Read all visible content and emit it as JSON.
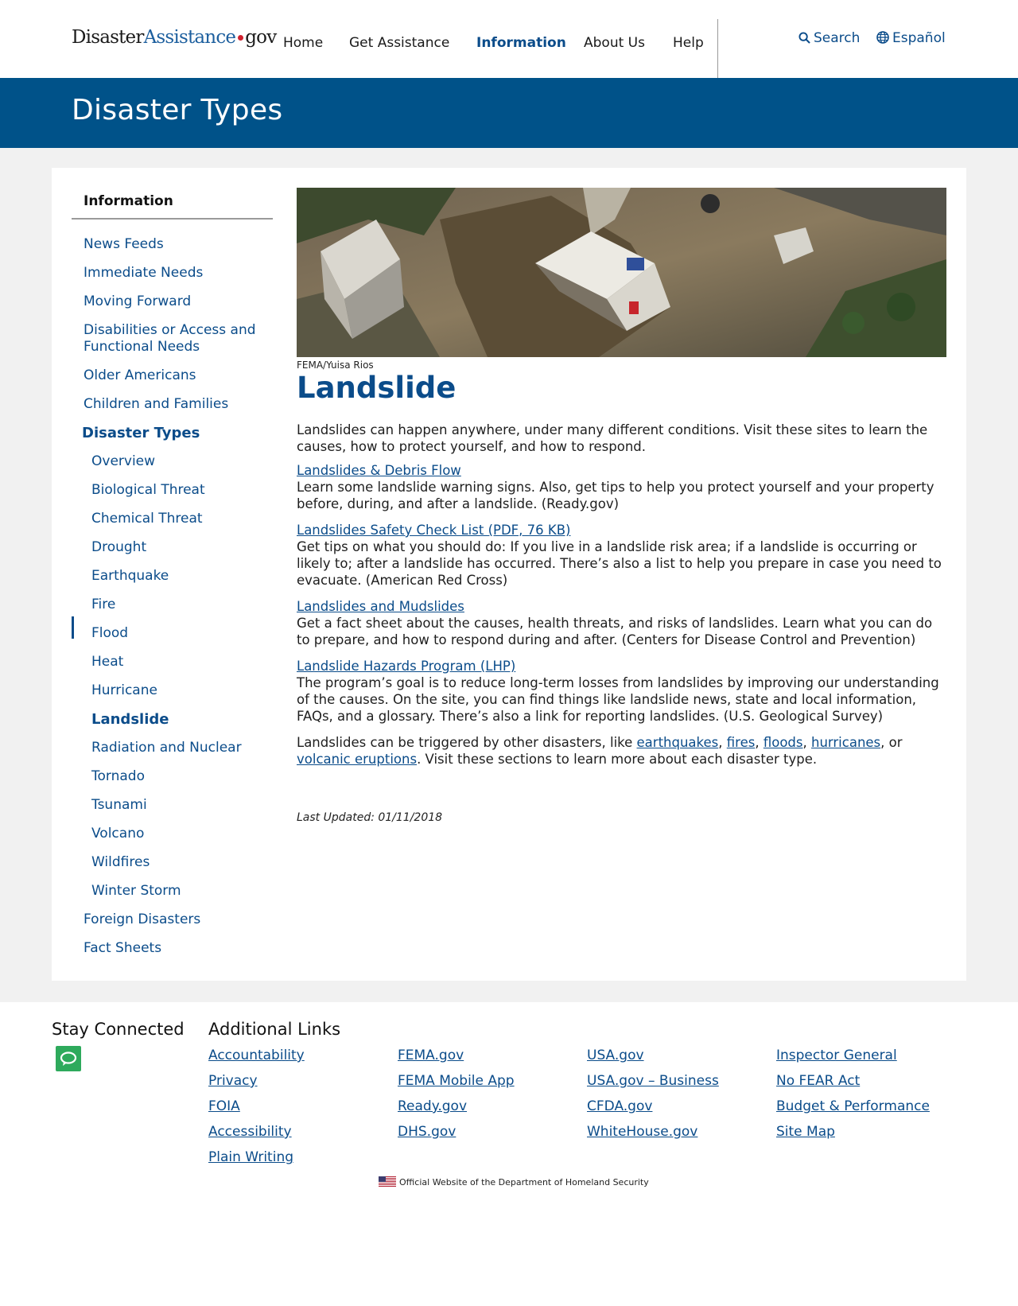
{
  "header": {
    "logo_part1": "Disaster",
    "logo_part2": "Assistance",
    "logo_part3": "gov",
    "nav": [
      "Home",
      "Get Assistance",
      "Information",
      "About Us",
      "Help"
    ],
    "active_nav": "Information",
    "search_label": "Search",
    "language_label": "Español"
  },
  "banner": {
    "title": "Disaster Types"
  },
  "sidenav": {
    "heading": "Information",
    "items_top": [
      "News Feeds",
      "Immediate Needs",
      "Moving Forward",
      "Disabilities or Access and",
      "Functional Needs",
      "Older Americans",
      "Children and Families"
    ],
    "section": "Disaster Types",
    "sub_items": [
      "Overview",
      "Biological Threat",
      "Chemical Threat",
      "Drought",
      "Earthquake",
      "Fire",
      "Flood",
      "Heat",
      "Hurricane",
      "Landslide",
      "Radiation and Nuclear",
      "Tornado",
      "Tsunami",
      "Volcano",
      "Wildfires",
      "Winter Storm"
    ],
    "current": "Landslide",
    "items_bottom": [
      "Foreign Disasters",
      "Fact Sheets"
    ]
  },
  "main": {
    "photo_credit": "FEMA/Yuisa Rios",
    "title": "Landslide",
    "intro": "Landslides can happen anywhere, under many different conditions. Visit these sites to learn the causes, how to protect yourself, and how to respond.",
    "resources": [
      {
        "link": "Landslides & Debris Flow",
        "desc": "Learn some landslide warning signs. Also, get tips to help you protect yourself and your property before, during, and after a landslide. (Ready.gov)"
      },
      {
        "link": "Landslides Safety Check List (PDF, 76 KB)",
        "desc": "Get tips on what you should do: If you live in a landslide risk area; if a landslide is occurring or likely to; after a landslide has occurred. There’s also a list to help you prepare in case you need to evacuate. (American Red Cross)"
      },
      {
        "link": "Landslides and Mudslides",
        "desc": "Get a fact sheet about the causes, health threats, and risks of landslides. Learn what you can do to prepare, and how to respond during and after. (Centers for Disease Control and Prevention)"
      },
      {
        "link": "Landslide Hazards Program (LHP)",
        "desc": "The program’s goal is to reduce long-term losses from landslides by improving our understanding of the causes. On the site, you can find things like landslide news, state and local information, FAQs, and a glossary. There’s also a link for reporting landslides. (U.S. Geological Survey)"
      }
    ],
    "closing_prefix": "Landslides can be triggered by other disasters, like ",
    "closing_links": [
      "earthquakes",
      "fires",
      "floods",
      "hurricanes",
      "volcanic eruptions"
    ],
    "closing_sep1": ", ",
    "closing_or": ", or ",
    "closing_suffix": ". Visit these sections to learn more about each disaster type.",
    "last_updated": "Last Updated: 01/11/2018"
  },
  "footer": {
    "stay_connected": "Stay Connected",
    "additional_links": "Additional Links",
    "columns": [
      [
        "Accountability",
        "Privacy",
        "FOIA",
        "Accessibility",
        "Plain Writing"
      ],
      [
        "FEMA.gov",
        "FEMA Mobile App",
        "Ready.gov",
        "DHS.gov"
      ],
      [
        "USA.gov",
        "USA.gov – Business",
        "CFDA.gov",
        "WhiteHouse.gov"
      ],
      [
        "Inspector General",
        "No FEAR Act",
        "Budget & Performance",
        "Site Map"
      ]
    ],
    "official": "Official Website of the Department of Homeland Security"
  },
  "colors": {
    "brand_blue": "#005289",
    "link_blue": "#0b4c8a",
    "chat_green": "#2eaa5c",
    "logo_dot": "#d0202e"
  },
  "icons": [
    "search-icon",
    "globe-icon",
    "chat-icon",
    "us-flag-icon"
  ]
}
